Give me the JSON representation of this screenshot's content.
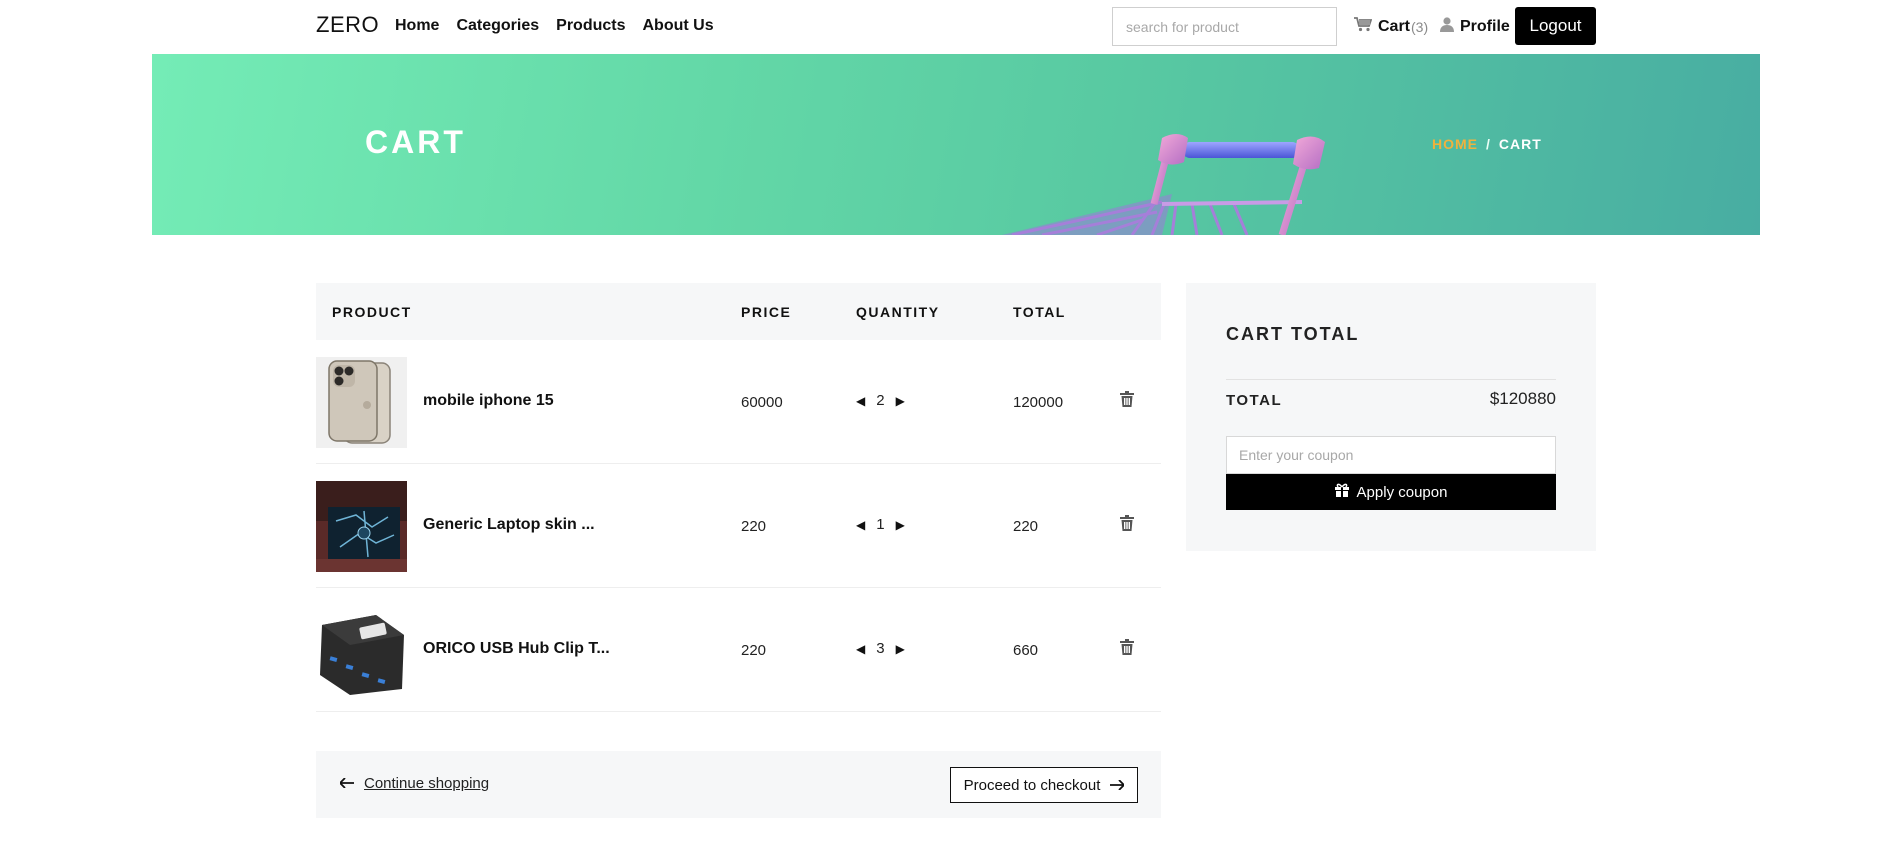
{
  "nav": {
    "brand": "ZERO",
    "links": [
      "Home",
      "Categories",
      "Products",
      "About Us"
    ],
    "search_placeholder": "search for product",
    "cart_label": "Cart",
    "cart_count": "(3)",
    "profile_label": "Profile",
    "logout_label": "Logout"
  },
  "hero": {
    "title": "CART",
    "breadcrumb_home": "HOME",
    "breadcrumb_sep": "/",
    "breadcrumb_current": "CART"
  },
  "table": {
    "headers": [
      "PRODUCT",
      "PRICE",
      "QUANTITY",
      "TOTAL"
    ],
    "rows": [
      {
        "name": "mobile iphone 15",
        "price": "60000",
        "quantity": "2",
        "total": "120000",
        "thumb": "iphone-thumbnail"
      },
      {
        "name": "Generic Laptop skin ...",
        "price": "220",
        "quantity": "1",
        "total": "220",
        "thumb": "laptop-skin-thumbnail"
      },
      {
        "name": "ORICO USB Hub Clip T...",
        "price": "220",
        "quantity": "3",
        "total": "660",
        "thumb": "usb-hub-thumbnail"
      }
    ]
  },
  "actions": {
    "continue_label": "Continue shopping",
    "checkout_label": "Proceed to checkout"
  },
  "cart_total": {
    "title": "CART TOTAL",
    "total_label": "TOTAL",
    "total_value": "$120880",
    "coupon_placeholder": "Enter your coupon",
    "apply_label": "Apply coupon"
  },
  "colors": {
    "accent": "#f0b23d",
    "hero_start": "#74ecb6",
    "hero_end": "#48ada2",
    "button_dark": "#000000"
  }
}
